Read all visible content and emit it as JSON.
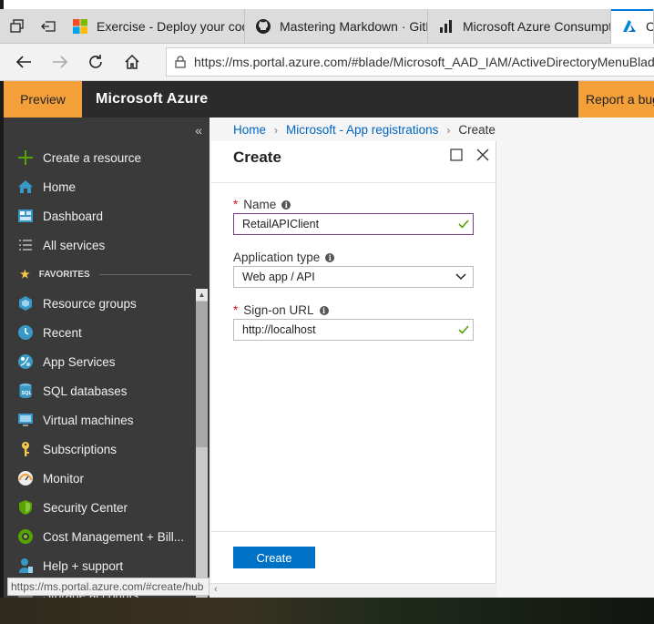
{
  "browser": {
    "tabs": [
      {
        "title": "Exercise - Deploy your code",
        "icon": "microsoft-logo-icon"
      },
      {
        "title": "Mastering Markdown · GitH",
        "icon": "github-icon"
      },
      {
        "title": "Microsoft Azure Consumptic",
        "icon": "bar-chart-icon"
      },
      {
        "title": "Cr",
        "icon": "azure-icon"
      }
    ],
    "url": "https://ms.portal.azure.com/#blade/Microsoft_AAD_IAM/ActiveDirectoryMenuBlade/Re"
  },
  "header": {
    "preview_label": "Preview",
    "brand": "Microsoft Azure",
    "report_label": "Report a bug"
  },
  "sidebar": {
    "items": [
      {
        "label": "Create a resource",
        "icon": "plus-icon"
      },
      {
        "label": "Home",
        "icon": "home-icon"
      },
      {
        "label": "Dashboard",
        "icon": "dashboard-icon"
      },
      {
        "label": "All services",
        "icon": "list-icon"
      }
    ],
    "favorites_label": "FAVORITES",
    "favorites": [
      {
        "label": "Resource groups",
        "icon": "resource-groups-icon"
      },
      {
        "label": "Recent",
        "icon": "clock-icon"
      },
      {
        "label": "App Services",
        "icon": "app-services-icon"
      },
      {
        "label": "SQL databases",
        "icon": "sql-database-icon"
      },
      {
        "label": "Virtual machines",
        "icon": "virtual-machine-icon"
      },
      {
        "label": "Subscriptions",
        "icon": "key-icon"
      },
      {
        "label": "Monitor",
        "icon": "gauge-icon"
      },
      {
        "label": "Security Center",
        "icon": "shield-icon"
      },
      {
        "label": "Cost Management + Bill...",
        "icon": "cost-management-icon"
      },
      {
        "label": "Help + support",
        "icon": "help-support-icon"
      },
      {
        "label": "Storage accounts",
        "icon": "storage-icon"
      }
    ]
  },
  "breadcrumb": {
    "items": [
      "Home",
      "Microsoft - App registrations",
      "Create"
    ]
  },
  "blade": {
    "title": "Create",
    "fields": {
      "name": {
        "label": "Name",
        "value": "RetailAPIClient",
        "required": true
      },
      "app_type": {
        "label": "Application type",
        "value": "Web app / API"
      },
      "signon": {
        "label": "Sign-on URL",
        "value": "http://localhost",
        "required": true
      }
    },
    "create_label": "Create"
  },
  "status_bar": "https://ms.portal.azure.com/#create/hub",
  "colors": {
    "accent": "#0072c6",
    "preview_orange": "#f3a03b",
    "sidebar_bg": "#3a3a3a",
    "header_bg": "#2b2b2b",
    "valid_green": "#57a300",
    "required_red": "#e00b1c"
  }
}
